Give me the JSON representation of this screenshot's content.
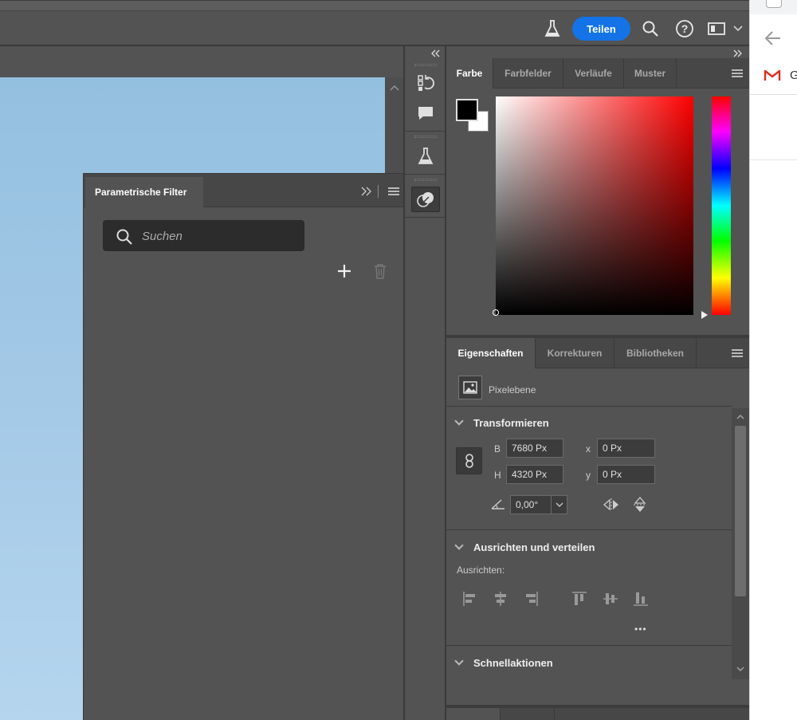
{
  "topbar": {
    "share_label": "Teilen",
    "icons": [
      "flask-icon",
      "search-icon",
      "help-icon",
      "workspace-icon",
      "chevron-down-icon"
    ]
  },
  "filter_panel": {
    "title": "Parametrische Filter",
    "search_placeholder": "Suchen"
  },
  "color_panel": {
    "tabs": [
      "Farbe",
      "Farbfelder",
      "Verläufe",
      "Muster"
    ],
    "active_tab": "Farbe",
    "foreground_color": "#000000",
    "background_color": "#ffffff",
    "hue_color": "#ff0000"
  },
  "properties_panel": {
    "tabs": [
      "Eigenschaften",
      "Korrekturen",
      "Bibliotheken"
    ],
    "active_tab": "Eigenschaften",
    "layer_type": "Pixelebene",
    "transform": {
      "heading": "Transformieren",
      "width_label": "B",
      "width_value": "7680 Px",
      "height_label": "H",
      "height_value": "4320 Px",
      "x_label": "x",
      "x_value": "0 Px",
      "y_label": "y",
      "y_value": "0 Px",
      "angle_value": "0,00°"
    },
    "align": {
      "heading": "Ausrichten und verteilen",
      "sub_label": "Ausrichten:",
      "more_label": "•••"
    },
    "quick_actions": {
      "heading": "Schnellaktionen"
    }
  },
  "browser_strip": {
    "gmail_letter": "G"
  }
}
